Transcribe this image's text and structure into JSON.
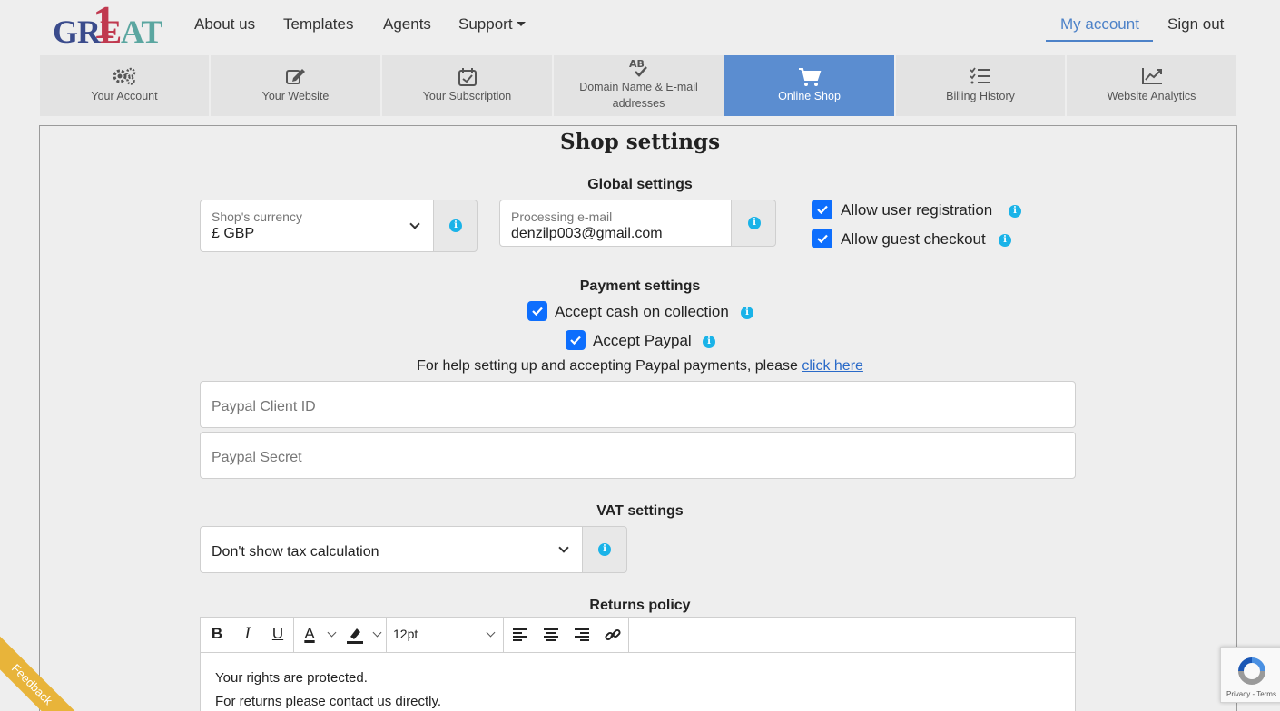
{
  "logo": {
    "letters": [
      "G",
      "R",
      "E",
      "A",
      "T"
    ],
    "one": "1"
  },
  "nav": {
    "links": [
      "About us",
      "Templates",
      "Agents",
      "Support"
    ],
    "my_account": "My account",
    "sign_out": "Sign out"
  },
  "tabs": [
    {
      "label": "Your Account",
      "icon": "gears-icon"
    },
    {
      "label": "Your Website",
      "icon": "edit-icon"
    },
    {
      "label": "Your Subscription",
      "icon": "calendar-check-icon"
    },
    {
      "label": "Domain Name & E-mail addresses",
      "icon": "spellcheck-icon"
    },
    {
      "label": "Online Shop",
      "icon": "cart-icon",
      "active": true
    },
    {
      "label": "Billing History",
      "icon": "list-check-icon"
    },
    {
      "label": "Website Analytics",
      "icon": "chart-line-icon"
    }
  ],
  "page": {
    "title": "Shop settings"
  },
  "global": {
    "heading": "Global settings",
    "currency_label": "Shop's currency",
    "currency_value": "£ GBP",
    "email_label": "Processing e-mail",
    "email_value": "denzilp003@gmail.com",
    "allow_registration": "Allow user registration",
    "allow_guest": "Allow guest checkout"
  },
  "payment": {
    "heading": "Payment settings",
    "cash": "Accept cash on collection",
    "paypal": "Accept Paypal",
    "help_text": "For help setting up and accepting Paypal payments, please ",
    "help_link": "click here",
    "client_id_placeholder": "Paypal Client ID",
    "secret_placeholder": "Paypal Secret"
  },
  "vat": {
    "heading": "VAT settings",
    "value": "Don't show tax calculation"
  },
  "returns": {
    "heading": "Returns policy",
    "font_size": "12pt",
    "lines": [
      "Your rights are protected.",
      "For returns please contact us directly."
    ]
  },
  "feedback": "Feedback",
  "recaptcha": "Privacy - Terms",
  "colors": {
    "accent": "#5b8dd0",
    "checkbox": "#0d6efd",
    "info": "#1ab3e8",
    "link": "#2a6ac8"
  }
}
